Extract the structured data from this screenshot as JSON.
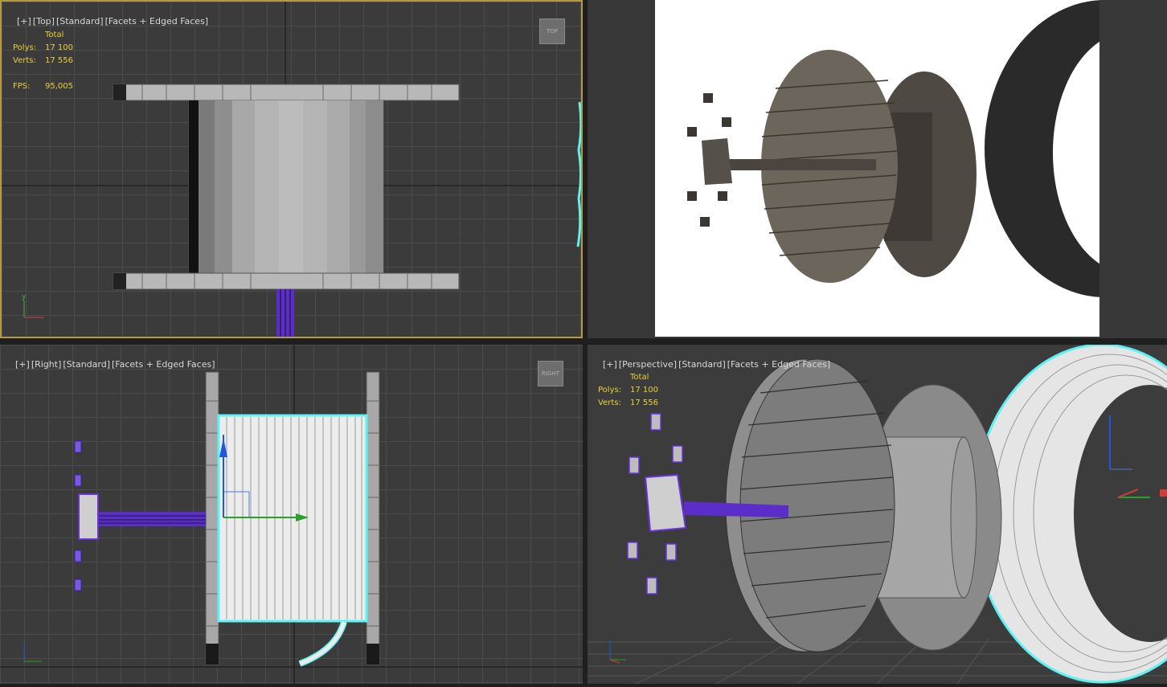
{
  "viewports": {
    "top": {
      "label": [
        "[+]",
        "[Top]",
        "[Standard]",
        "[Facets + Edged Faces]"
      ],
      "viewcube": "TOP",
      "stats": {
        "total_label": "Total",
        "polys_label": "Polys:",
        "polys_value": "17 100",
        "verts_label": "Verts:",
        "verts_value": "17 556",
        "fps_label": "FPS:",
        "fps_value": "95,005"
      }
    },
    "render": {},
    "right": {
      "label": [
        "[+]",
        "[Right]",
        "[Standard]",
        "[Facets + Edged Faces]"
      ],
      "viewcube": "RIGHT"
    },
    "perspective": {
      "label": [
        "[+]",
        "[Perspective]",
        "[Standard]",
        "[Facets + Edged Faces]"
      ],
      "stats": {
        "total_label": "Total",
        "polys_label": "Polys:",
        "polys_value": "17 100",
        "verts_label": "Verts:",
        "verts_value": "17 556"
      }
    }
  },
  "colors": {
    "active_border": "#b59a45",
    "stat_text": "#e8d03a",
    "selection_cyan": "#5ff2f2",
    "selection_purple": "#6a33d6"
  },
  "icons": [
    "axis-gizmo-icon",
    "viewcube-icon",
    "transform-gizmo-icon"
  ]
}
